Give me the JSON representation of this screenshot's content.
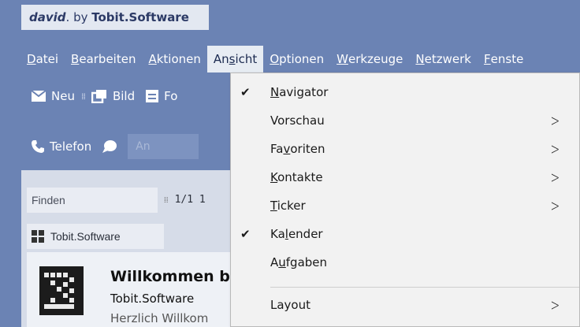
{
  "app": {
    "logo": {
      "brand": "david",
      "by": ". by ",
      "company": "Tobit.Software"
    }
  },
  "menubar": [
    {
      "label_pre": "",
      "label_ul": "D",
      "label_post": "atei"
    },
    {
      "label_pre": "",
      "label_ul": "B",
      "label_post": "earbeiten"
    },
    {
      "label_pre": "",
      "label_ul": "A",
      "label_post": "ktionen"
    },
    {
      "label_pre": "An",
      "label_ul": "s",
      "label_post": "icht"
    },
    {
      "label_pre": "",
      "label_ul": "O",
      "label_post": "ptionen"
    },
    {
      "label_pre": "",
      "label_ul": "W",
      "label_post": "erkzeuge"
    },
    {
      "label_pre": "",
      "label_ul": "N",
      "label_post": "etzwerk"
    },
    {
      "label_pre": "",
      "label_ul": "F",
      "label_post": "enste"
    }
  ],
  "toolbar": {
    "new_label": "Neu",
    "image_label": "Bild",
    "form_label": "Fo",
    "phone_label": "Telefon",
    "to_placeholder": "An"
  },
  "panel": {
    "find_placeholder": "Finden",
    "paging": "1/1  1",
    "folder_name": "Tobit.Software"
  },
  "message": {
    "title": "Willkommen b",
    "sender": "Tobit.Software",
    "preview": "Herzlich Willkom"
  },
  "dropdown": {
    "items": [
      {
        "pre": "",
        "ul": "N",
        "post": "avigator",
        "checked": true,
        "submenu": false
      },
      {
        "pre": "Vorschau",
        "ul": "",
        "post": "",
        "checked": false,
        "submenu": true
      },
      {
        "pre": "Fa",
        "ul": "v",
        "post": "oriten",
        "checked": false,
        "submenu": true
      },
      {
        "pre": "",
        "ul": "K",
        "post": "ontakte",
        "checked": false,
        "submenu": true
      },
      {
        "pre": "",
        "ul": "T",
        "post": "icker",
        "checked": false,
        "submenu": true
      },
      {
        "pre": "Ka",
        "ul": "l",
        "post": "ender",
        "checked": true,
        "submenu": false
      },
      {
        "pre": "A",
        "ul": "u",
        "post": "fgaben",
        "checked": false,
        "submenu": false
      },
      {
        "pre": "Layout",
        "ul": "",
        "post": "",
        "checked": false,
        "submenu": true
      }
    ]
  },
  "colors": {
    "background": "#6b83b4",
    "menu_active": "#e7ecf3",
    "dropdown_bg": "#f2f2f2"
  }
}
